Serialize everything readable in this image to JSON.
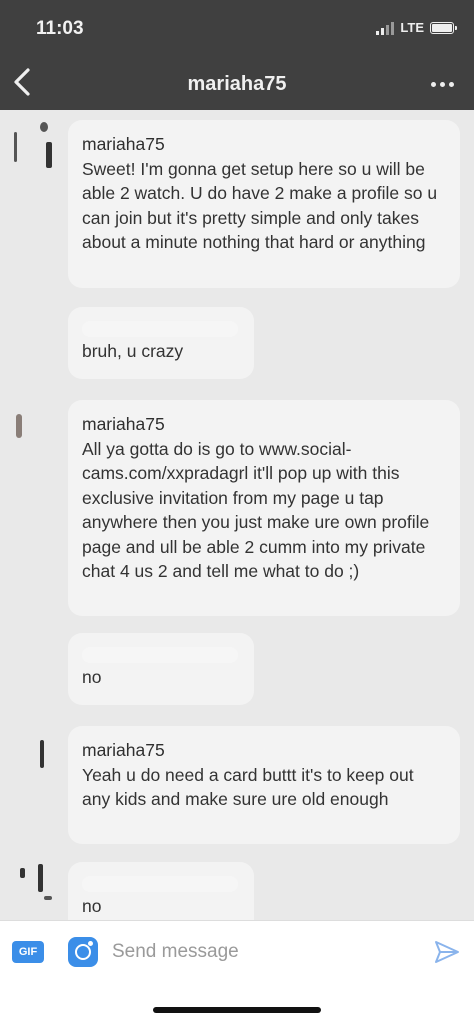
{
  "status_bar": {
    "time": "11:03",
    "network": "LTE"
  },
  "nav": {
    "title": "mariaha75",
    "back_icon": "chevron-left-icon",
    "more_icon": "ellipsis-icon"
  },
  "messages": [
    {
      "sender": "mariaha75",
      "text": "Sweet! I'm gonna get setup here so u will be able 2 watch. U do have 2 make a profile so u can join but it's pretty simple and only takes about a minute nothing that hard or anything"
    },
    {
      "sender": "",
      "text": "bruh, u crazy"
    },
    {
      "sender": "mariaha75",
      "text": "All ya gotta do is go to www.social-cams.com/xxpradagrl  it'll pop up with this exclusive invitation from my page u tap anywhere then you just make ure own profile page and ull be able 2 cumm into my private chat 4 us 2  and tell me what to do ;)"
    },
    {
      "sender": "",
      "text": "no"
    },
    {
      "sender": "mariaha75",
      "text": "Yeah u do need a card  buttt it's to keep out any kids and make sure ure old enough"
    },
    {
      "sender": "",
      "text": "no"
    }
  ],
  "composer": {
    "gif_label": "GIF",
    "placeholder": "Send message",
    "camera_icon": "camera-icon",
    "send_icon": "send-icon"
  },
  "colors": {
    "header_bg": "#404040",
    "background": "#e9e9e9",
    "bubble_bg": "#f3f3f3",
    "accent": "#3b8ee8"
  }
}
